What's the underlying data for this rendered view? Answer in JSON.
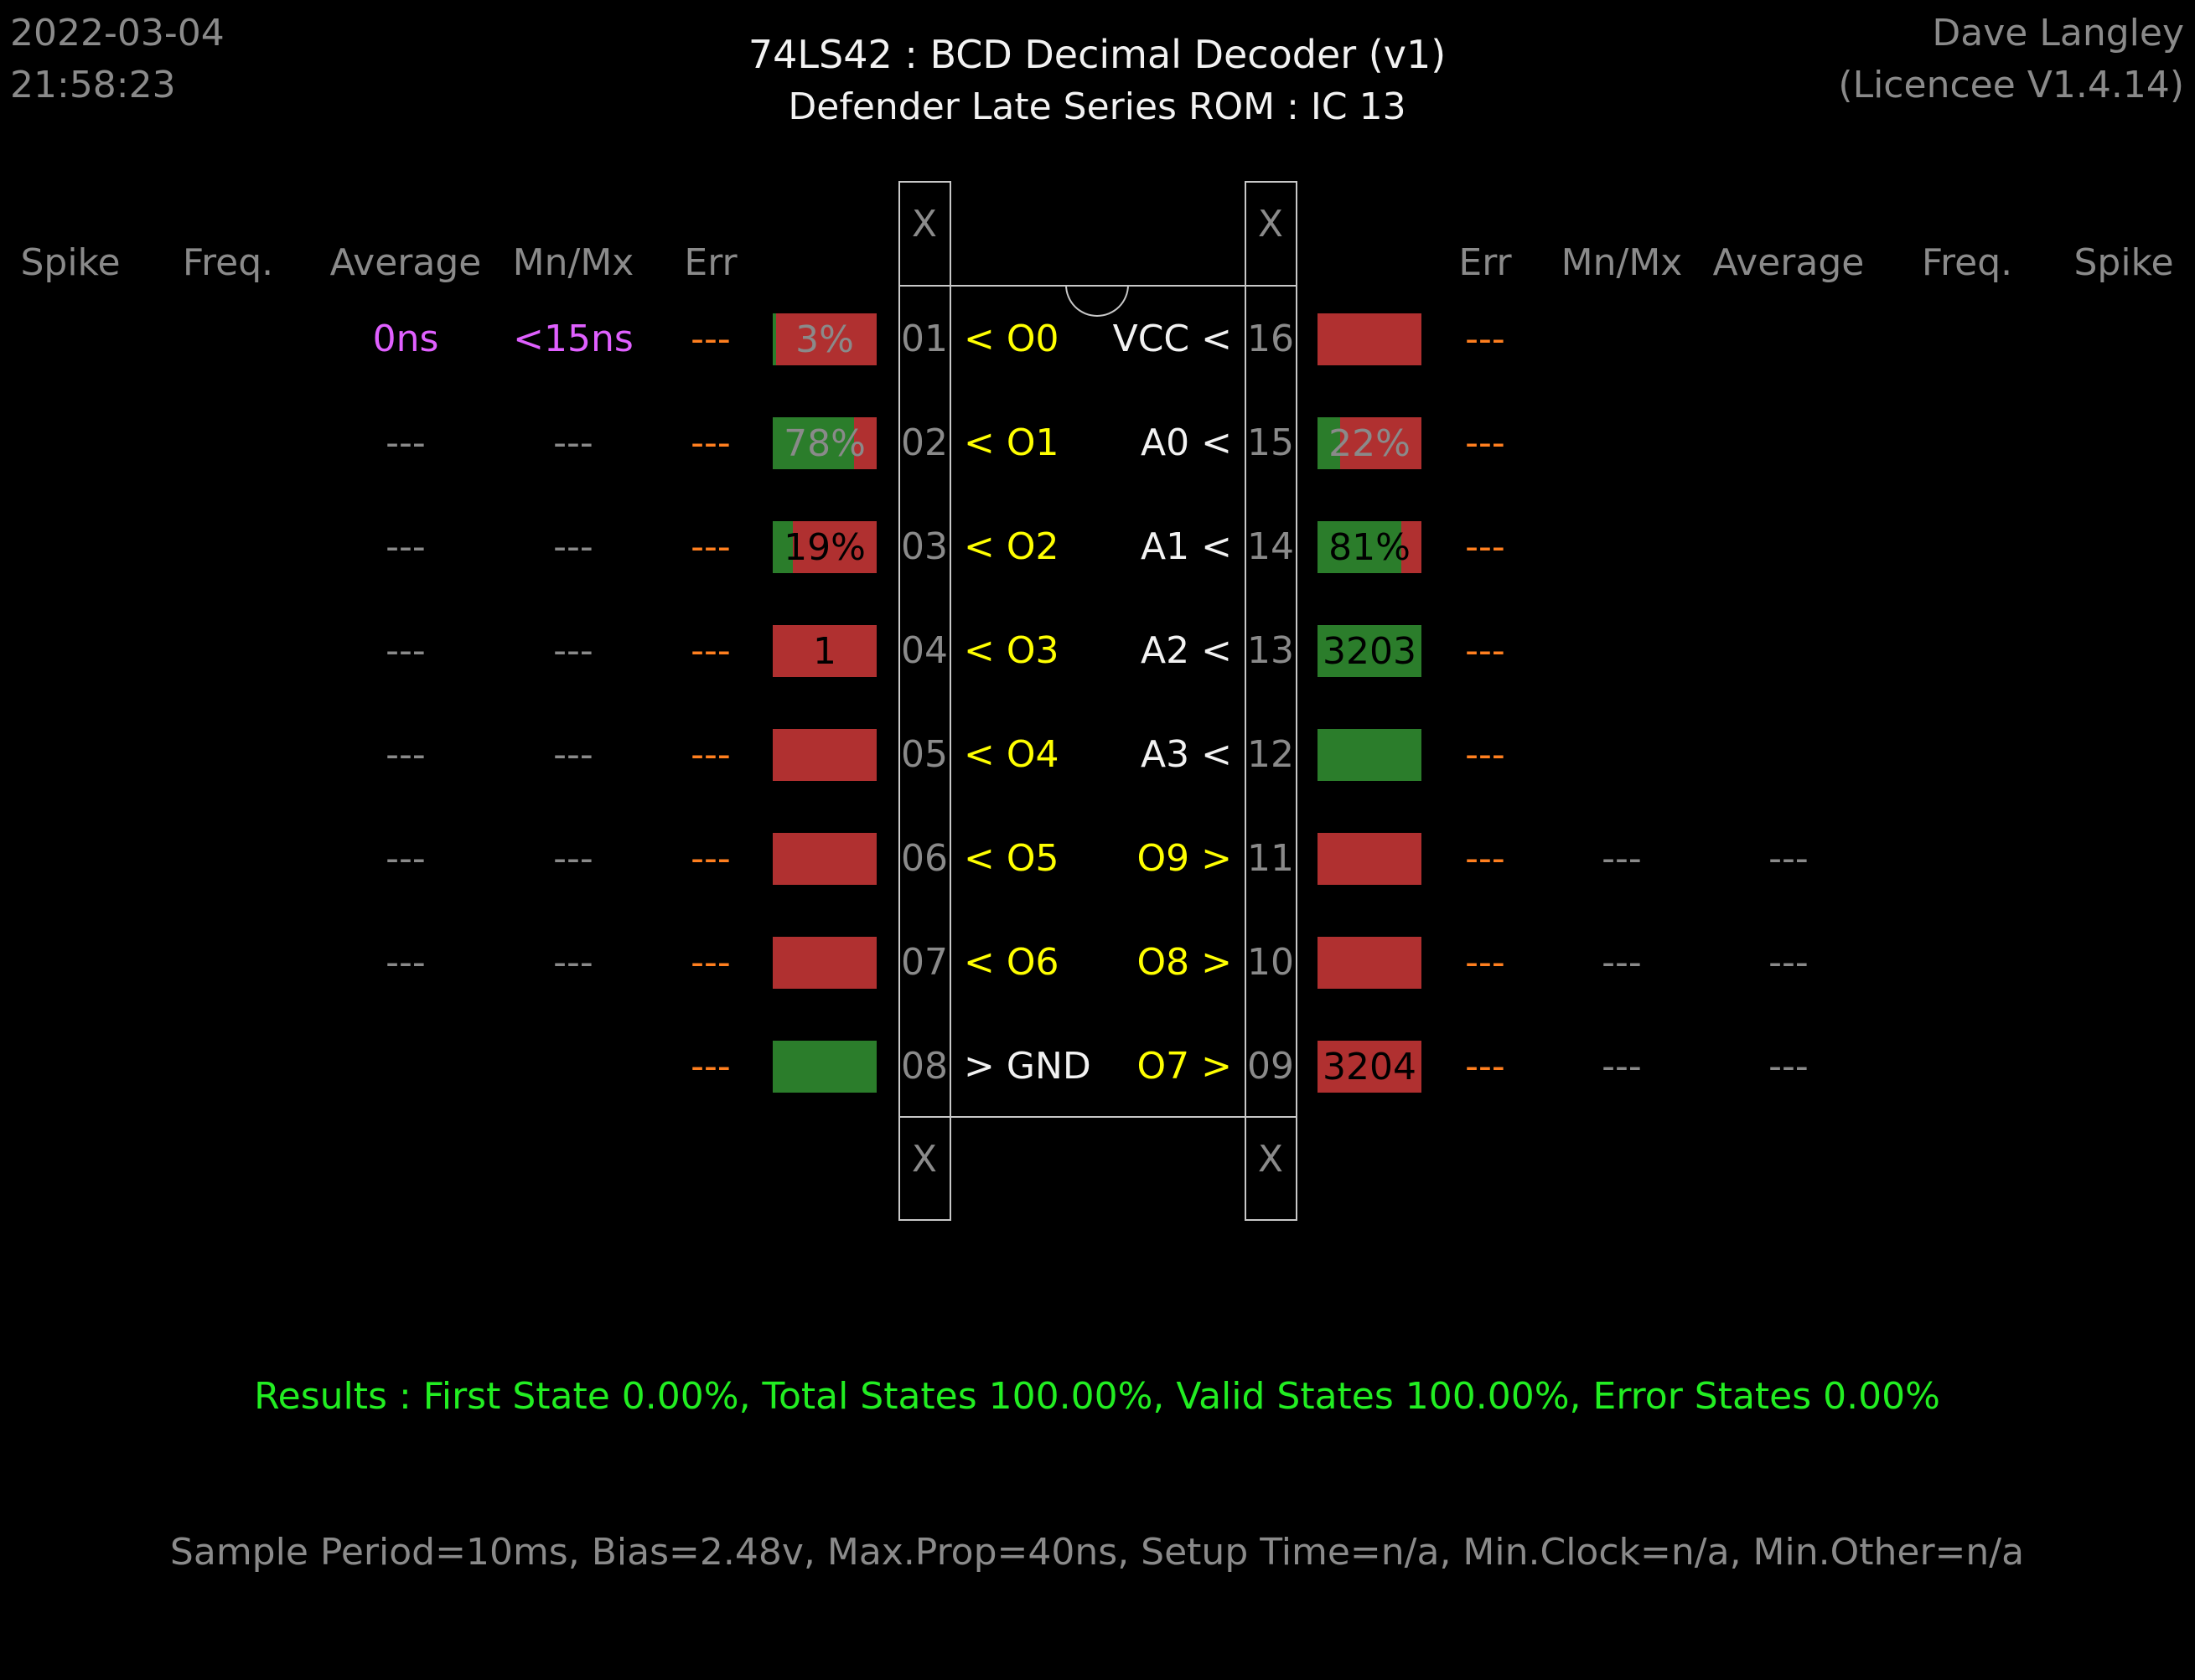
{
  "header": {
    "date": "2022-03-04",
    "time": "21:58:23",
    "title": "74LS42  :  BCD Decimal Decoder (v1)",
    "subtitle": "Defender Late Series ROM : IC 13",
    "user": "Dave Langley",
    "licence": "(Licencee V1.4.14)"
  },
  "columns_left": [
    "Spike",
    "Freq.",
    "Average",
    "Mn/Mx",
    "Err"
  ],
  "columns_right": [
    "Err",
    "Mn/Mx",
    "Average",
    "Freq.",
    "Spike"
  ],
  "x_mark": "X",
  "left_pins": [
    {
      "num": "01",
      "name": "< O0",
      "color": "yellow",
      "err": "---",
      "avg": "0ns",
      "mnmx": "<15ns",
      "stat_color": "violet",
      "bar": {
        "bg": "red",
        "green_pct": 3,
        "label": "3%",
        "label_color": "gray"
      }
    },
    {
      "num": "02",
      "name": "< O1",
      "color": "yellow",
      "err": "---",
      "avg": "---",
      "mnmx": "---",
      "stat_color": "gray",
      "bar": {
        "bg": "red",
        "green_pct": 78,
        "label": "78%",
        "label_color": "gray"
      }
    },
    {
      "num": "03",
      "name": "< O2",
      "color": "yellow",
      "err": "---",
      "avg": "---",
      "mnmx": "---",
      "stat_color": "gray",
      "bar": {
        "bg": "red",
        "green_pct": 19,
        "label": "19%",
        "label_color": "black"
      }
    },
    {
      "num": "04",
      "name": "< O3",
      "color": "yellow",
      "err": "---",
      "avg": "---",
      "mnmx": "---",
      "stat_color": "gray",
      "bar": {
        "bg": "red",
        "green_pct": 0,
        "label": "1",
        "label_color": "black"
      }
    },
    {
      "num": "05",
      "name": "< O4",
      "color": "yellow",
      "err": "---",
      "avg": "---",
      "mnmx": "---",
      "stat_color": "gray",
      "bar": {
        "bg": "red",
        "green_pct": 0,
        "label": "",
        "label_color": "black"
      }
    },
    {
      "num": "06",
      "name": "< O5",
      "color": "yellow",
      "err": "---",
      "avg": "---",
      "mnmx": "---",
      "stat_color": "gray",
      "bar": {
        "bg": "red",
        "green_pct": 0,
        "label": "",
        "label_color": "black"
      }
    },
    {
      "num": "07",
      "name": "< O6",
      "color": "yellow",
      "err": "---",
      "avg": "---",
      "mnmx": "---",
      "stat_color": "gray",
      "bar": {
        "bg": "red",
        "green_pct": 0,
        "label": "",
        "label_color": "black"
      }
    },
    {
      "num": "08",
      "name": "> GND",
      "color": "white",
      "err": "---",
      "avg": "",
      "mnmx": "",
      "stat_color": "gray",
      "bar": {
        "bg": "green",
        "green_pct": 100,
        "label": "",
        "label_color": "black"
      }
    }
  ],
  "right_pins": [
    {
      "num": "16",
      "name": "VCC <",
      "color": "white",
      "err": "---",
      "mnmx": "",
      "avg": "",
      "bar": {
        "bg": "red",
        "green_pct": 0,
        "label": "",
        "label_color": "black"
      }
    },
    {
      "num": "15",
      "name": "A0 <",
      "color": "white",
      "err": "---",
      "mnmx": "",
      "avg": "",
      "bar": {
        "bg": "red",
        "green_pct": 22,
        "label": "22%",
        "label_color": "gray"
      }
    },
    {
      "num": "14",
      "name": "A1 <",
      "color": "white",
      "err": "---",
      "mnmx": "",
      "avg": "",
      "bar": {
        "bg": "red",
        "green_pct": 81,
        "label": "81%",
        "label_color": "black"
      }
    },
    {
      "num": "13",
      "name": "A2 <",
      "color": "white",
      "err": "---",
      "mnmx": "",
      "avg": "",
      "bar": {
        "bg": "green",
        "green_pct": 100,
        "label": "3203",
        "label_color": "black"
      }
    },
    {
      "num": "12",
      "name": "A3 <",
      "color": "white",
      "err": "---",
      "mnmx": "",
      "avg": "",
      "bar": {
        "bg": "green",
        "green_pct": 100,
        "label": "",
        "label_color": "black"
      }
    },
    {
      "num": "11",
      "name": "O9 >",
      "color": "yellow",
      "err": "---",
      "mnmx": "---",
      "avg": "---",
      "bar": {
        "bg": "red",
        "green_pct": 0,
        "label": "",
        "label_color": "black"
      }
    },
    {
      "num": "10",
      "name": "O8 >",
      "color": "yellow",
      "err": "---",
      "mnmx": "---",
      "avg": "---",
      "bar": {
        "bg": "red",
        "green_pct": 0,
        "label": "",
        "label_color": "black"
      }
    },
    {
      "num": "09",
      "name": "O7 >",
      "color": "yellow",
      "err": "---",
      "mnmx": "---",
      "avg": "---",
      "bar": {
        "bg": "red",
        "green_pct": 0,
        "label": "3204",
        "label_color": "black"
      }
    }
  ],
  "results": "Results  :  First State 0.00%,  Total States 100.00%,  Valid States 100.00%,  Error States 0.00%",
  "settings": "Sample Period=10ms,  Bias=2.48v,  Max.Prop=40ns,  Setup Time=n/a,  Min.Clock=n/a,  Min.Other=n/a"
}
